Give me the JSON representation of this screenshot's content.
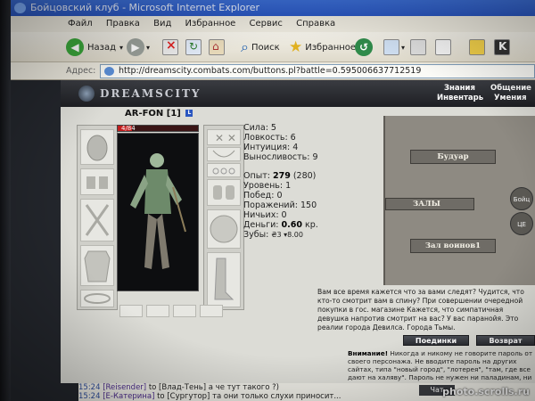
{
  "window": {
    "title": "Бойцовский клуб - Microsoft Internet Explorer"
  },
  "menu": [
    "Файл",
    "Правка",
    "Вид",
    "Избранное",
    "Сервис",
    "Справка"
  ],
  "toolbar": {
    "back_label": "Назад",
    "search_label": "Поиск",
    "favorites_label": "Избранное"
  },
  "address": {
    "label": "Адрес:",
    "url": "http://dreamscity.combats.com/buttons.pl?battle=0.595006637712519"
  },
  "game": {
    "logo": "DREAMSCITY",
    "nav": [
      "Знания",
      "Общение",
      "Инвентарь",
      "Умения"
    ],
    "character": {
      "name": "AR-FON",
      "level": "[1]",
      "badge": "L",
      "hp": "4/84"
    },
    "stats": {
      "strength": "Сила: 5",
      "agility": "Ловкость: 6",
      "intuition": "Интуиция: 4",
      "endurance": "Выносливость: 9",
      "exp_label": "Опыт:",
      "exp_value": "279",
      "exp_next": "(280)",
      "level": "Уровень: 1",
      "wins": "Побед: 0",
      "losses": "Поражений: 150",
      "draws": "Ничьих: 0",
      "money_label": "Деньги:",
      "money_value": "0.60",
      "money_unit": "кр.",
      "teeth_label": "Зубы:",
      "teeth_value": "₴3 ▾8.00"
    },
    "map": {
      "budoar": "Будуар",
      "zaly": "ЗАЛЫ",
      "zal_voinov": "Зал воинов1",
      "circle1": "Бойц",
      "circle2": "ЦЕ"
    },
    "warning_text": "Вам все время кажется что за вами следят? Чудится, что кто-то смотрит вам в спину? При совершении очередной покупки в гос. магазине Кажется, что симпатичная девушка напротив смотрит на вас? У вас паранойя. Это реалии города Девилса. Города Тьмы.",
    "buttons": {
      "fights": "Поединки",
      "return": "Возврат"
    },
    "notice_bold": "Внимание!",
    "notice_text": " Никогда и никому не говорите пароль от своего персонажа. Не вводите пароль на других сайтах, типа \"новый город\", \"лотерея\", \"там, где все дают на халяву\". Пароль не нужен ни паладинам, ни кланам, ни администрации."
  },
  "chat": {
    "lines": [
      {
        "time": "15:24",
        "nick": "[Reisender]",
        "text": " to [Влад-Тень] а че тут такого ?)"
      },
      {
        "time": "15:24",
        "nick": "[E-Катерина]",
        "text": " to [Сургутор] та они только слухи приносит..."
      }
    ],
    "tab": "Чат"
  },
  "watermark": "photo.scrolls.ru",
  "colors": {
    "title_blue": "#2a56c0",
    "hp_red": "#c21e1e",
    "header_dark": "#1e1f23"
  }
}
